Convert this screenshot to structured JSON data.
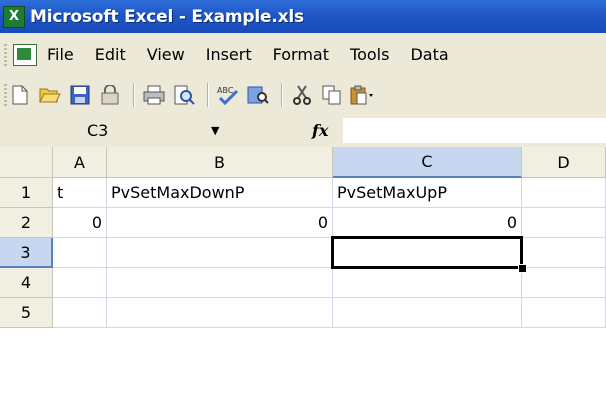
{
  "window": {
    "title": "Microsoft Excel - Example.xls",
    "app_icon": "X"
  },
  "menu": {
    "items": [
      "File",
      "Edit",
      "View",
      "Insert",
      "Format",
      "Tools",
      "Data"
    ]
  },
  "toolbar": {
    "icons": [
      "new-icon",
      "open-icon",
      "save-icon",
      "permission-icon",
      "print-icon",
      "print-preview-icon",
      "spelling-icon",
      "research-icon",
      "cut-icon",
      "copy-icon",
      "paste-icon"
    ]
  },
  "formula_bar": {
    "name_box": "C3",
    "fx": "fx",
    "value": ""
  },
  "grid": {
    "columns": [
      "A",
      "B",
      "C",
      "D"
    ],
    "rows": [
      "1",
      "2",
      "3",
      "4",
      "5"
    ],
    "cells": {
      "A1": "t",
      "B1": "PvSetMaxDownP",
      "C1": "PvSetMaxUpP",
      "A2": "0",
      "B2": "0",
      "C2": "0"
    },
    "selected_cell": "C3",
    "selected_column": "C",
    "selected_row": "3"
  },
  "colors": {
    "title_bar": "#1f56c7",
    "chrome": "#ece9d8",
    "header_selected": "#c8d7f0"
  }
}
